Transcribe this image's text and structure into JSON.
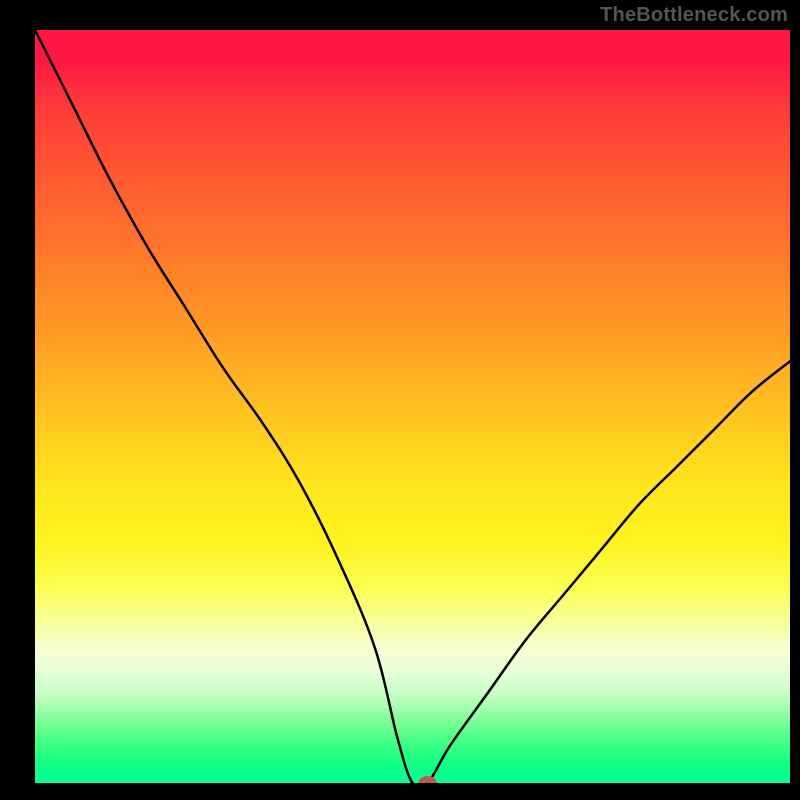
{
  "watermark": "TheBottleneck.com",
  "chart_data": {
    "type": "line",
    "title": "",
    "xlabel": "",
    "ylabel": "",
    "xlim": [
      0,
      100
    ],
    "ylim": [
      0,
      100
    ],
    "x": [
      0,
      5,
      10,
      15,
      20,
      25,
      30,
      35,
      40,
      45,
      48,
      50,
      52,
      55,
      60,
      65,
      70,
      75,
      80,
      85,
      90,
      95,
      100
    ],
    "values": [
      100,
      90,
      80,
      71,
      63,
      55,
      48,
      40,
      30,
      18,
      6,
      0,
      0,
      5,
      12,
      19,
      25,
      31,
      37,
      42,
      47,
      52,
      56
    ],
    "marker": {
      "x": 52,
      "y": 0,
      "color": "#c25655"
    },
    "background_gradient": [
      "#ff1744",
      "#ff9a24",
      "#fff31e",
      "#00ff99"
    ]
  }
}
